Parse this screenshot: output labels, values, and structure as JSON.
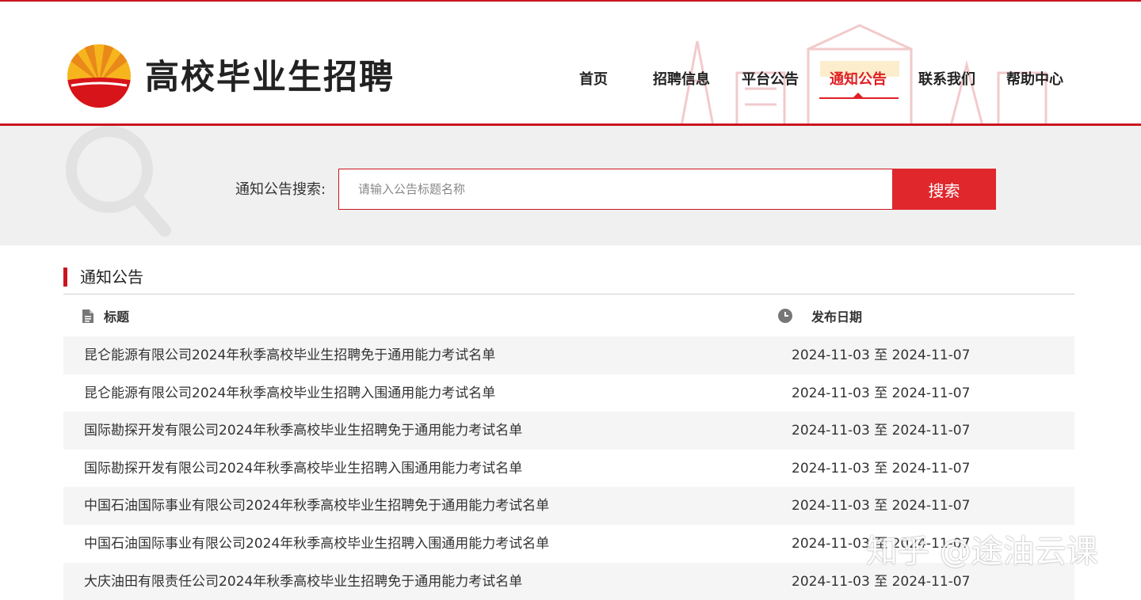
{
  "site": {
    "title": "高校毕业生招聘"
  },
  "nav": {
    "items": [
      {
        "label": "首页"
      },
      {
        "label": "招聘信息"
      },
      {
        "label": "平台公告"
      },
      {
        "label": "通知公告"
      },
      {
        "label": "联系我们"
      },
      {
        "label": "帮助中心"
      }
    ],
    "active": "通知公告"
  },
  "search": {
    "label": "通知公告搜索:",
    "placeholder": "请输入公告标题名称",
    "value": "",
    "button_label": "搜索"
  },
  "section": {
    "title": "通知公告"
  },
  "table": {
    "headers": {
      "title": "标题",
      "date": "发布日期"
    },
    "rows": [
      {
        "title": "昆仑能源有限公司2024年秋季高校毕业生招聘免于通用能力考试名单",
        "date": "2024-11-03 至 2024-11-07"
      },
      {
        "title": "昆仑能源有限公司2024年秋季高校毕业生招聘入围通用能力考试名单",
        "date": "2024-11-03 至 2024-11-07"
      },
      {
        "title": "国际勘探开发有限公司2024年秋季高校毕业生招聘免于通用能力考试名单",
        "date": "2024-11-03 至 2024-11-07"
      },
      {
        "title": "国际勘探开发有限公司2024年秋季高校毕业生招聘入围通用能力考试名单",
        "date": "2024-11-03 至 2024-11-07"
      },
      {
        "title": "中国石油国际事业有限公司2024年秋季高校毕业生招聘免于通用能力考试名单",
        "date": "2024-11-03 至 2024-11-07"
      },
      {
        "title": "中国石油国际事业有限公司2024年秋季高校毕业生招聘入围通用能力考试名单",
        "date": "2024-11-03 至 2024-11-07"
      },
      {
        "title": "大庆油田有限责任公司2024年秋季高校毕业生招聘免于通用能力考试名单",
        "date": "2024-11-03 至 2024-11-07"
      }
    ]
  },
  "watermark": "知乎 @途油云课",
  "colors": {
    "brand_red": "#c9151e",
    "button_red": "#e0272c",
    "logo_yellow": "#f6b51d"
  },
  "icons": {
    "logo": "petrochina-logo",
    "search_deco": "magnifier-icon",
    "title_col": "document-icon",
    "date_col": "clock-icon"
  }
}
